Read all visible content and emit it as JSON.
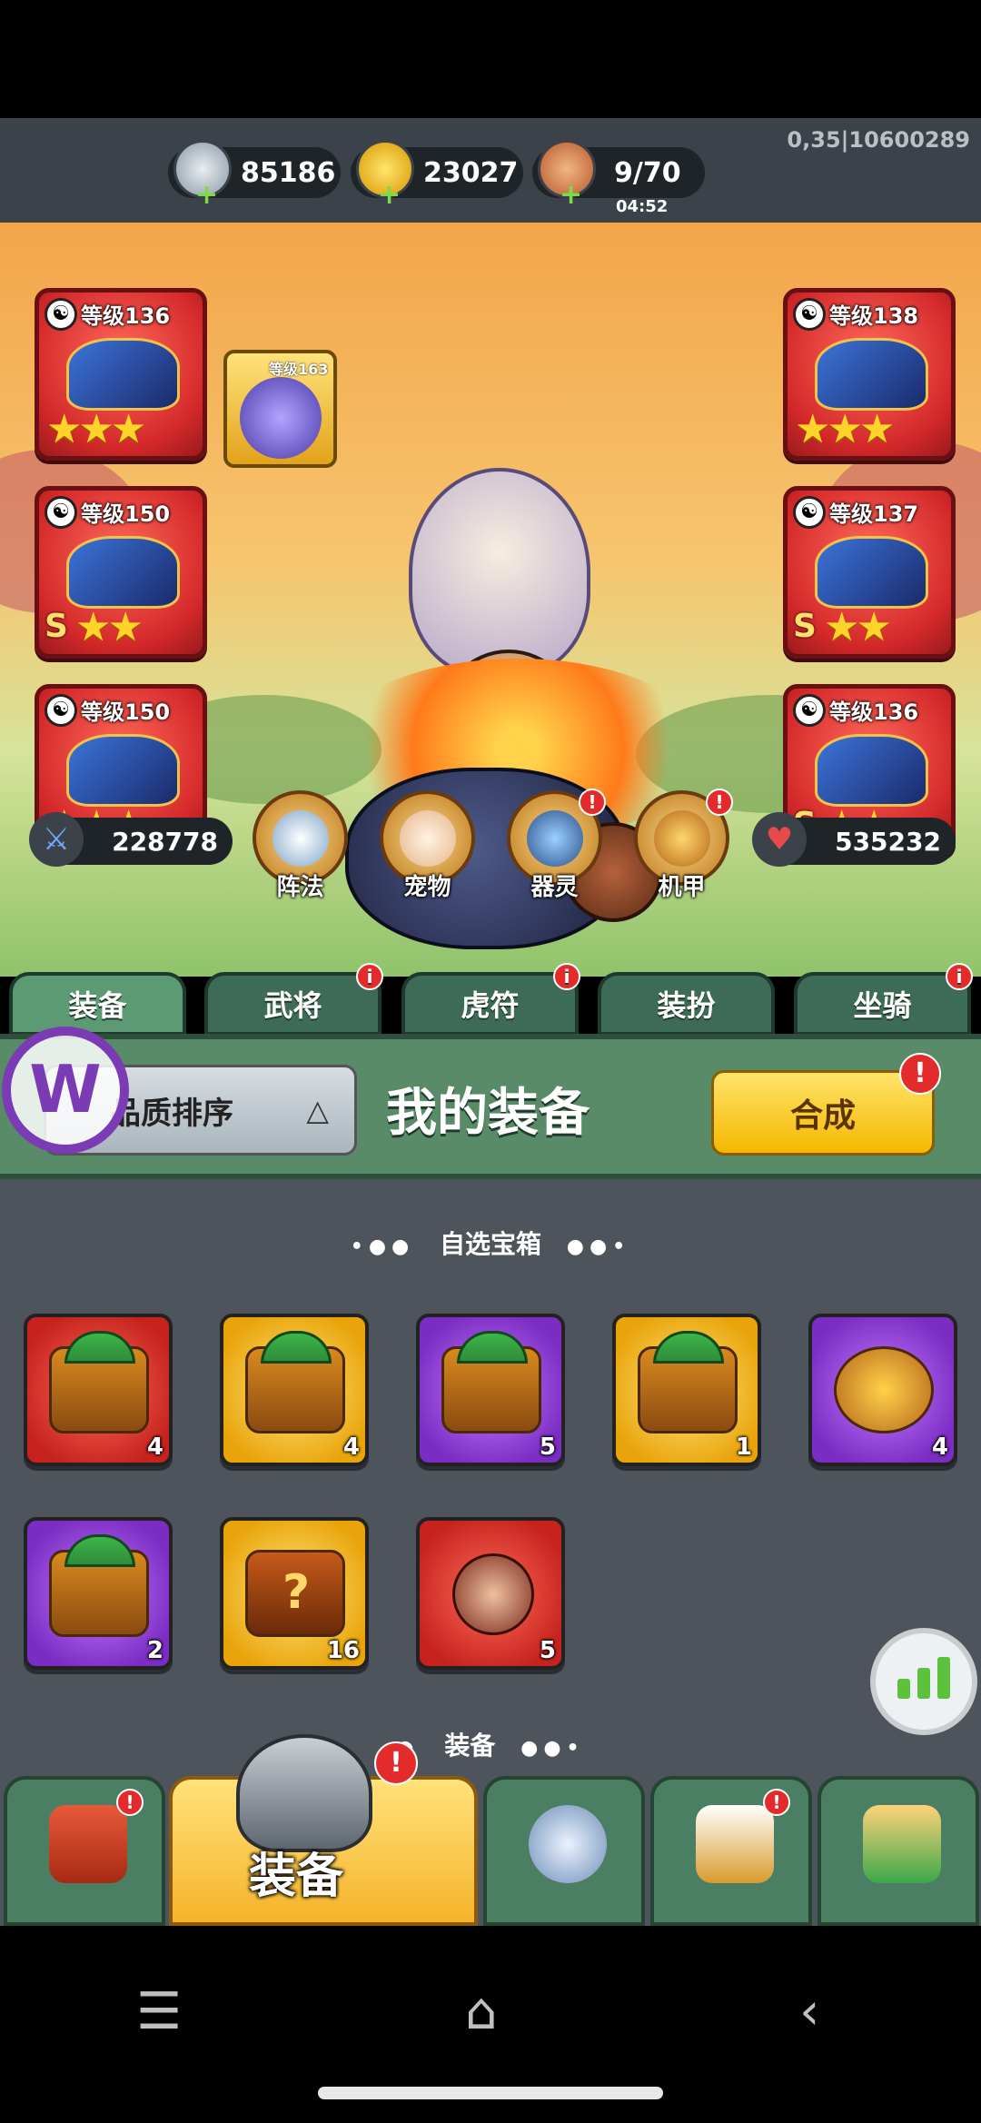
{
  "resources": {
    "silver": {
      "value": "85186",
      "icon": "silver-coin-icon"
    },
    "gold": {
      "value": "23027",
      "icon": "gold-ingot-icon"
    },
    "stamina": {
      "value": "9/70",
      "timer": "04:52",
      "icon": "meat-icon"
    }
  },
  "version": "0,35|10600289",
  "equipment_slots": [
    {
      "level": "等级136",
      "stars": "★★★",
      "grade": ""
    },
    {
      "level": "等级150",
      "stars": "★★",
      "grade": "S"
    },
    {
      "level": "等级150",
      "stars": "★★★",
      "grade": ""
    },
    {
      "level": "等级138",
      "stars": "★★★",
      "grade": ""
    },
    {
      "level": "等级137",
      "stars": "★★",
      "grade": "S"
    },
    {
      "level": "等级136",
      "stars": "★★",
      "grade": "S"
    }
  ],
  "companion_level": "等级163",
  "attack_power": "228778",
  "health": "535232",
  "functions": [
    {
      "label": "阵法",
      "badge": ""
    },
    {
      "label": "宠物",
      "badge": ""
    },
    {
      "label": "器灵",
      "badge": "!"
    },
    {
      "label": "机甲",
      "badge": "!"
    }
  ],
  "tabs": [
    {
      "label": "装备",
      "badge": ""
    },
    {
      "label": "武将",
      "badge": "i"
    },
    {
      "label": "虎符",
      "badge": "i"
    },
    {
      "label": "装扮",
      "badge": ""
    },
    {
      "label": "坐骑",
      "badge": "i"
    }
  ],
  "panel": {
    "sort_label": "品质排序",
    "sort_arrow": "△",
    "title": "我的装备",
    "merge_label": "合成",
    "merge_badge": "!"
  },
  "section_chest": {
    "title": "自选宝箱",
    "dots_left": "•●●",
    "dots_right": "●●•"
  },
  "section_equip": {
    "title": "装备",
    "dots_left": "●",
    "dots_right": "●●•"
  },
  "items": [
    {
      "color": "red",
      "count": "4"
    },
    {
      "color": "gold",
      "count": "4"
    },
    {
      "color": "purple",
      "count": "5"
    },
    {
      "color": "gold",
      "count": "1"
    },
    {
      "color": "purple",
      "count": "4"
    },
    {
      "color": "purple",
      "count": "2"
    },
    {
      "color": "gold",
      "count": "16"
    },
    {
      "color": "red",
      "count": "5"
    }
  ],
  "bottom_nav": {
    "active_label": "装备",
    "badge": "!"
  },
  "colors": {
    "accent": "#f5b800",
    "panel": "#5a8b69",
    "badge": "#e42b2b"
  }
}
